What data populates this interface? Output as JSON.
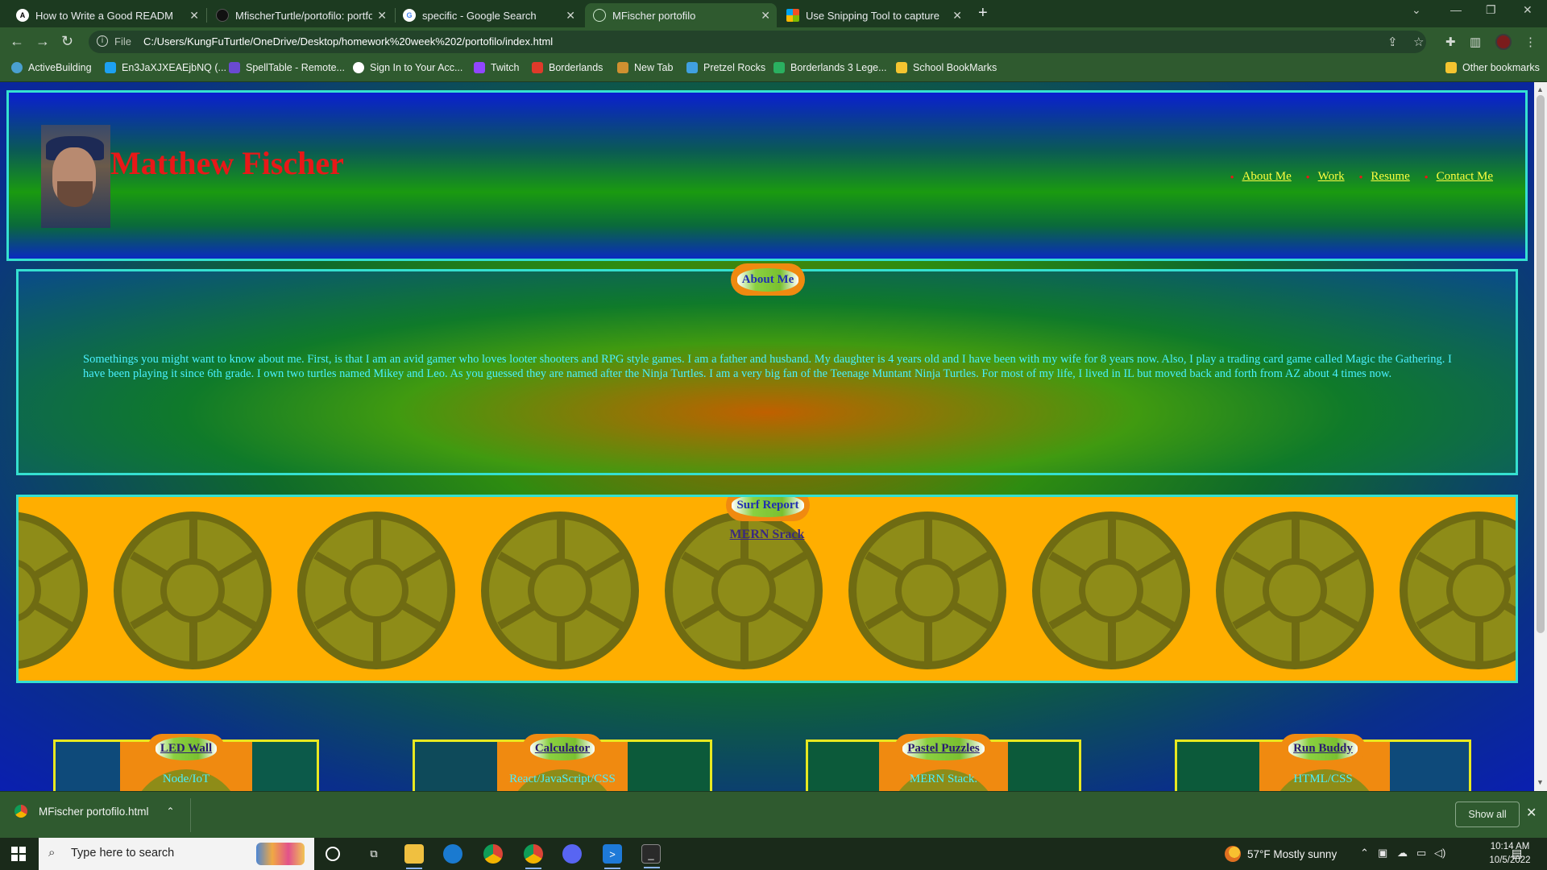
{
  "browser": {
    "tabs": [
      {
        "title": "How to Write a Good README F",
        "icon": "readme-logo-icon",
        "color": "#ffffff"
      },
      {
        "title": "MfischerTurtle/portofilo: portfolio",
        "icon": "github-icon",
        "color": "#111111"
      },
      {
        "title": "specific - Google Search",
        "icon": "google-icon",
        "color": "#ffffff"
      },
      {
        "title": "MFischer portofilo",
        "icon": "globe-icon",
        "color": "#cfe8cf",
        "active": true
      },
      {
        "title": "Use Snipping Tool to capture scre",
        "icon": "microsoft-icon",
        "color": "#f25022"
      }
    ],
    "new_tab": "+",
    "address": {
      "prefix": "File",
      "url": "C:/Users/KungFuTurtle/OneDrive/Desktop/homework%20week%202/portofilo/index.html"
    },
    "bookmarks": [
      {
        "label": "ActiveBuilding",
        "color": "#4aa0d0"
      },
      {
        "label": "En3JaXJXEAEjbNQ (...",
        "color": "#1da1f2"
      },
      {
        "label": "SpellTable - Remote...",
        "color": "#6a4ad0"
      },
      {
        "label": "Sign In to Your Acc...",
        "color": "#ffffff"
      },
      {
        "label": "Twitch",
        "color": "#9146ff"
      },
      {
        "label": "Borderlands",
        "color": "#e03a2a"
      },
      {
        "label": "New Tab",
        "color": "#d09030"
      },
      {
        "label": "Pretzel Rocks",
        "color": "#40a0e0"
      },
      {
        "label": "Borderlands 3 Lege...",
        "color": "#2ab060"
      },
      {
        "label": "School BookMarks",
        "color": "#f4c430"
      }
    ],
    "other_bookmarks": "Other bookmarks"
  },
  "site": {
    "name": "Matthew Fischer",
    "nav": [
      "About Me",
      "Work",
      "Resume",
      "Contact Me"
    ],
    "about": {
      "title": "About Me",
      "text": "Somethings you might want to know about me. First, is that I am an avid gamer who loves looter shooters and RPG style games. I am a father and husband. My daughter is 4 years old and I have been with my wife for 8 years now. Also, I play a trading card game called Magic the Gathering. I have been playing it since 6th grade. I own two turtles named Mikey and Leo. As you guessed they are named after the Ninja Turtles. I am a very big fan of the Teenage Muntant Ninja Turtles. For most of my life, I lived in IL but moved back and forth from AZ about 4 times now."
    },
    "surf": {
      "title": "Surf Report",
      "link": "MERN Srack"
    },
    "projects": [
      {
        "title": "LED Wall",
        "tech": "Node/IoT"
      },
      {
        "title": "Calculator",
        "tech": "React/JavaScript/CSS"
      },
      {
        "title": "Pastel Puzzles",
        "tech": "MERN Stack."
      },
      {
        "title": "Run Buddy",
        "tech": "HTML/CSS"
      }
    ]
  },
  "downloads": {
    "file": "MFischer portofilo.html",
    "show_all": "Show all"
  },
  "taskbar": {
    "search_placeholder": "Type here to search",
    "weather": "57°F  Mostly sunny",
    "time": "10:14 AM",
    "date": "10/5/2022"
  }
}
